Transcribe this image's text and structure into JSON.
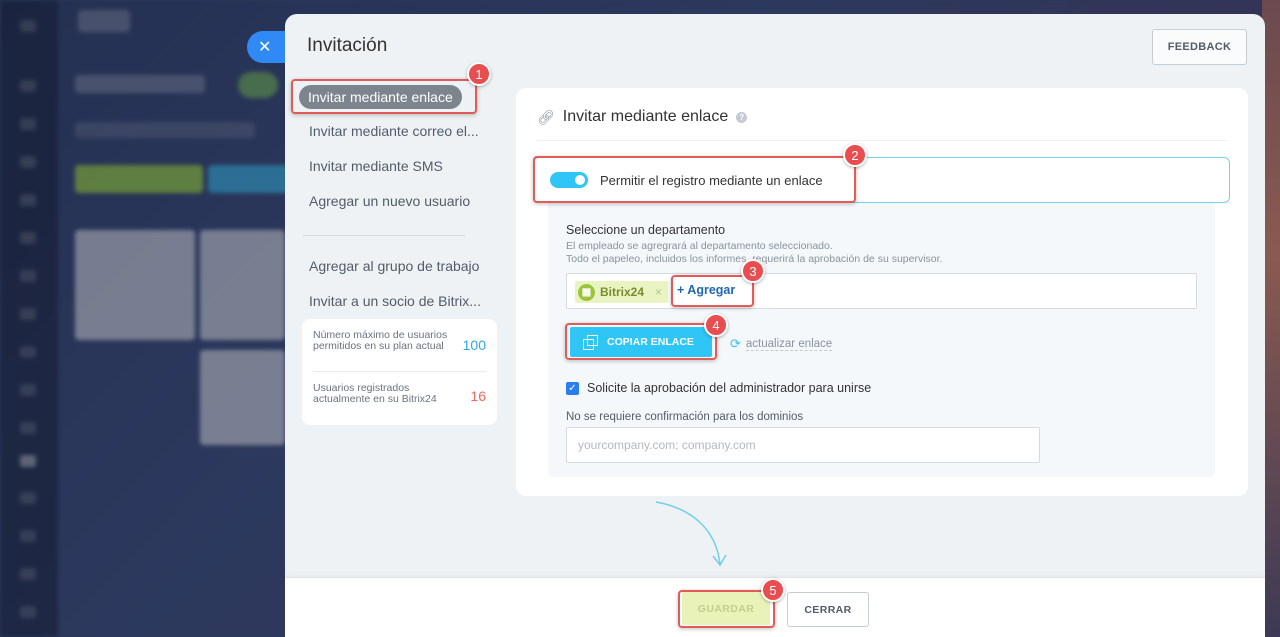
{
  "panel": {
    "title": "Invitación",
    "feedback_label": "FEEDBACK"
  },
  "menu": {
    "items": [
      {
        "label": "Invitar mediante enlace"
      },
      {
        "label": "Invitar mediante correo el..."
      },
      {
        "label": "Invitar mediante SMS"
      },
      {
        "label": "Agregar un nuevo usuario"
      },
      {
        "label": "Agregar al grupo de trabajo"
      },
      {
        "label": "Invitar a un socio de Bitrix..."
      }
    ],
    "active_index": 0
  },
  "stats": {
    "max_users_label": "Número máximo de usuarios permitidos en su plan actual",
    "max_users_value": "100",
    "max_users_color": "#2fa9e0",
    "registered_label": "Usuarios registrados actualmente en su Bitrix24",
    "registered_value": "16",
    "registered_color": "#f0695a"
  },
  "card": {
    "title": "Invitar mediante enlace",
    "toggle_label": "Permitir el registro mediante un enlace",
    "toggle_on": true,
    "dept_title": "Seleccione un departamento",
    "dept_desc_1": "El empleado se agregrará al departamento seleccionado.",
    "dept_desc_2": "Todo el papeleo, incluidos los informes, requerirá la aprobación de su supervisor.",
    "dept_tag": "Bitrix24",
    "add_label": "+ Agregar",
    "copy_label": "COPIAR ENLACE",
    "refresh_label": "actualizar enlace",
    "approval_label": "Solicite la aprobación del administrador para unirse",
    "approval_checked": true,
    "domains_label": "No se requiere confirmación para los dominios",
    "domains_placeholder": "yourcompany.com; company.com",
    "domains_value": ""
  },
  "footer": {
    "save_label": "GUARDAR",
    "close_label": "CERRAR"
  },
  "annotations": [
    "1",
    "2",
    "3",
    "4",
    "5"
  ],
  "colors": {
    "accent": "#2fc6f6",
    "annotation": "#e84d4f",
    "save_bg": "#e9f2b8"
  }
}
